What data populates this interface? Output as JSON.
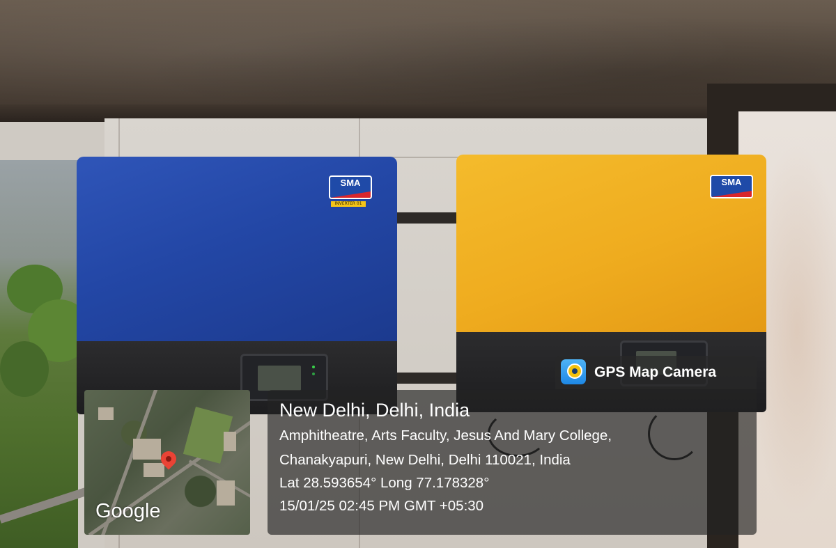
{
  "overlay": {
    "app_name": "GPS Map Camera",
    "app_icon": "gps-map-camera-icon",
    "location_title": "New Delhi, Delhi, India",
    "address_line_1": "Amphitheatre, Arts Faculty, Jesus And Mary College,",
    "address_line_2": "Chanakyapuri, New Delhi, Delhi 110021, India",
    "coordinates": "Lat 28.593654° Long 77.178328°",
    "timestamp": "15/01/25 02:45 PM GMT +05:30",
    "map_brand": "Google",
    "map_pin_icon": "map-pin-icon"
  },
  "scene": {
    "inverter_left": {
      "logo": "SMA",
      "label": "INVERTER 01",
      "color": "#2347a6"
    },
    "inverter_right": {
      "logo": "SMA",
      "color": "#efac1f"
    }
  }
}
